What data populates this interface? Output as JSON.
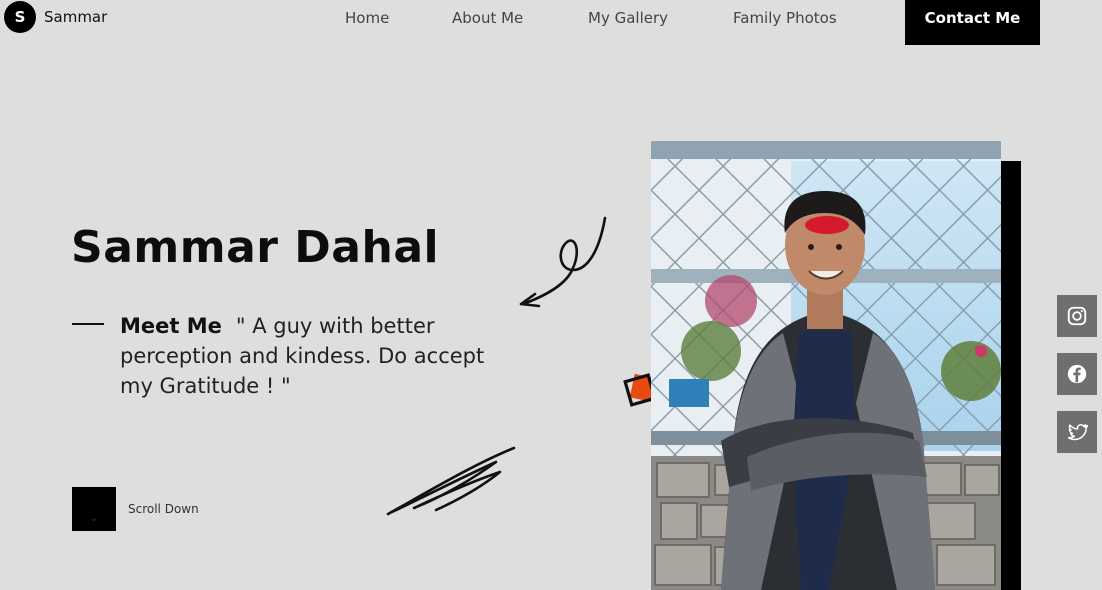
{
  "brand": {
    "initial": "S",
    "name": "Sammar"
  },
  "nav": {
    "items": [
      "Home",
      "About Me",
      "My Gallery",
      "Family Photos"
    ],
    "contact_label": "Contact Me"
  },
  "hero": {
    "title": "Sammar Dahal",
    "meet_label": "Meet Me",
    "quote": "\" A guy with better perception and kindess. Do accept my Gratitude ! \""
  },
  "scroll": {
    "label": "Scroll Down",
    "icon": "chevron-down-icon"
  },
  "socials": [
    {
      "name": "instagram",
      "icon": "instagram-icon"
    },
    {
      "name": "facebook",
      "icon": "facebook-icon"
    },
    {
      "name": "twitter",
      "icon": "twitter-icon"
    }
  ],
  "colors": {
    "background": "#dedede",
    "accent": "#000000",
    "social_bg": "#6f6f6f",
    "decor_orange": "#e84a12"
  }
}
